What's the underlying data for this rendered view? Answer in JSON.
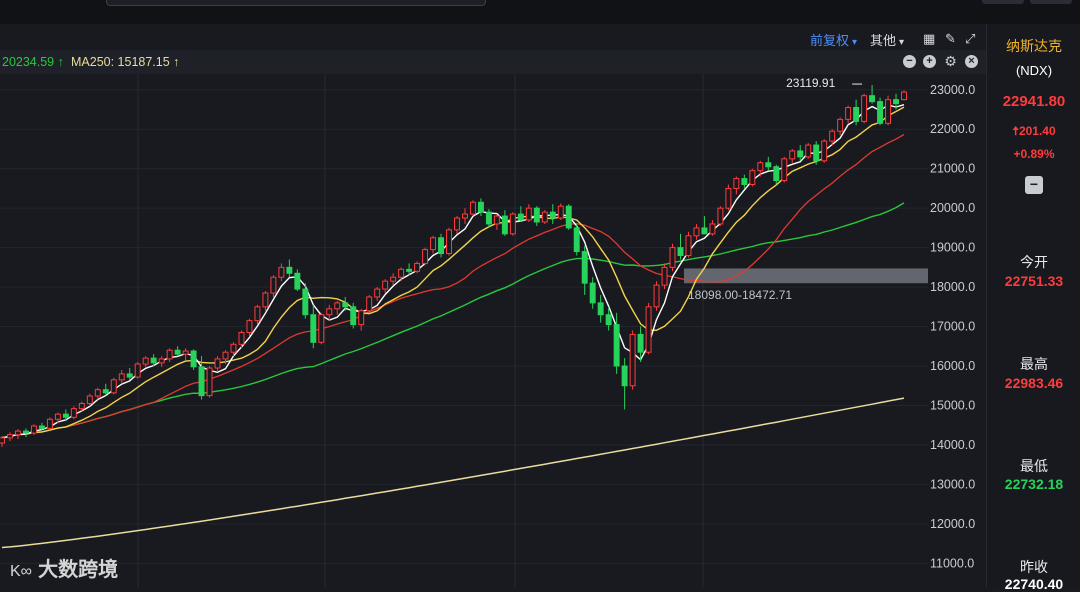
{
  "toolbar": {
    "adjust_label": "前复权",
    "other_label": "其他",
    "icons": [
      "grid-icon",
      "brush-icon",
      "expand-icon"
    ]
  },
  "ma_bar": {
    "ma_partial": "20234.59 ↑",
    "ma250": "MA250: 15187.15 ↑",
    "controls": [
      "minus-icon",
      "plus-icon",
      "gear-icon",
      "close-icon"
    ]
  },
  "sidebar": {
    "name": "纳斯达克",
    "code": "(NDX)",
    "price": "22941.80",
    "change": "201.40",
    "change_pct": "+0.89%",
    "open_label": "今开",
    "open_value": "22751.33",
    "high_label": "最高",
    "high_value": "22983.46",
    "low_label": "最低",
    "low_value": "22732.18",
    "prev_label": "昨收",
    "prev_value": "22740.40"
  },
  "watermark": {
    "text": "大数跨境",
    "logo": "K∞"
  },
  "colors": {
    "up": "#ff3b3b",
    "down": "#27d35a",
    "ma5": "#ffffff",
    "ma10": "#f3d34a",
    "ma20": "#e2392d",
    "ma60": "#28c83c",
    "ma250": "#e9dc9c",
    "accent": "#f0b429"
  },
  "chart_data": {
    "type": "candlestick",
    "y_ticks": [
      "23000.0",
      "22000.0",
      "21000.0",
      "20000.0",
      "19000.0",
      "18000.0",
      "17000.0",
      "16000.0",
      "15000.0",
      "14000.0",
      "13000.0",
      "12000.0",
      "11000.0"
    ],
    "ylim": [
      10400,
      23400
    ],
    "grid": true,
    "annotations": {
      "high_marker": "23119.91",
      "range_label": "18098.00-18472.71",
      "range": [
        18098.0,
        18472.71
      ]
    },
    "candles": [
      [
        14050,
        14230,
        13950,
        14180
      ],
      [
        14180,
        14320,
        14100,
        14260
      ],
      [
        14260,
        14400,
        14150,
        14350
      ],
      [
        14350,
        14420,
        14200,
        14300
      ],
      [
        14300,
        14520,
        14250,
        14480
      ],
      [
        14480,
        14560,
        14380,
        14420
      ],
      [
        14420,
        14700,
        14380,
        14650
      ],
      [
        14650,
        14820,
        14550,
        14780
      ],
      [
        14780,
        14900,
        14600,
        14700
      ],
      [
        14700,
        14980,
        14650,
        14920
      ],
      [
        14920,
        15100,
        14850,
        15050
      ],
      [
        15050,
        15300,
        14980,
        15240
      ],
      [
        15240,
        15450,
        15150,
        15400
      ],
      [
        15400,
        15550,
        15250,
        15320
      ],
      [
        15320,
        15700,
        15280,
        15650
      ],
      [
        15650,
        15900,
        15550,
        15800
      ],
      [
        15800,
        15950,
        15650,
        15720
      ],
      [
        15720,
        16100,
        15680,
        16050
      ],
      [
        16050,
        16250,
        15950,
        16200
      ],
      [
        16200,
        16300,
        16000,
        16080
      ],
      [
        16080,
        16250,
        15980,
        16180
      ],
      [
        16180,
        16450,
        16100,
        16400
      ],
      [
        16400,
        16500,
        16250,
        16300
      ],
      [
        16300,
        16450,
        16150,
        16380
      ],
      [
        16380,
        16420,
        15900,
        15980
      ],
      [
        15980,
        16250,
        15150,
        15250
      ],
      [
        15250,
        16000,
        15200,
        15950
      ],
      [
        15950,
        16250,
        15850,
        16180
      ],
      [
        16180,
        16400,
        16050,
        16350
      ],
      [
        16350,
        16600,
        16250,
        16550
      ],
      [
        16550,
        16900,
        16450,
        16850
      ],
      [
        16850,
        17200,
        16750,
        17150
      ],
      [
        17150,
        17550,
        17050,
        17500
      ],
      [
        17500,
        17900,
        17400,
        17850
      ],
      [
        17850,
        18300,
        17750,
        18250
      ],
      [
        18250,
        18600,
        18150,
        18500
      ],
      [
        18500,
        18700,
        18250,
        18350
      ],
      [
        18350,
        18450,
        17900,
        17950
      ],
      [
        17950,
        18100,
        17200,
        17300
      ],
      [
        17300,
        17550,
        16450,
        16600
      ],
      [
        16600,
        17350,
        16550,
        17300
      ],
      [
        17300,
        17550,
        17150,
        17450
      ],
      [
        17450,
        17650,
        17300,
        17600
      ],
      [
        17600,
        17750,
        17400,
        17500
      ],
      [
        17500,
        17600,
        16950,
        17050
      ],
      [
        17050,
        17450,
        16900,
        17400
      ],
      [
        17400,
        17800,
        17350,
        17750
      ],
      [
        17750,
        18000,
        17650,
        17950
      ],
      [
        17950,
        18200,
        17850,
        18150
      ],
      [
        18150,
        18350,
        18050,
        18250
      ],
      [
        18250,
        18500,
        18150,
        18450
      ],
      [
        18450,
        18600,
        18300,
        18400
      ],
      [
        18400,
        18650,
        18350,
        18600
      ],
      [
        18600,
        19000,
        18550,
        18950
      ],
      [
        18950,
        19300,
        18850,
        19250
      ],
      [
        19250,
        19350,
        18750,
        18850
      ],
      [
        18850,
        19500,
        18800,
        19450
      ],
      [
        19450,
        19800,
        19350,
        19750
      ],
      [
        19750,
        20000,
        19600,
        19850
      ],
      [
        19850,
        20200,
        19800,
        20150
      ],
      [
        20150,
        20250,
        19800,
        19900
      ],
      [
        19900,
        19980,
        19500,
        19600
      ],
      [
        19600,
        19850,
        19450,
        19800
      ],
      [
        19800,
        19950,
        19300,
        19350
      ],
      [
        19350,
        19900,
        19300,
        19850
      ],
      [
        19850,
        20050,
        19650,
        19700
      ],
      [
        19700,
        20100,
        19650,
        20000
      ],
      [
        20000,
        20050,
        19550,
        19650
      ],
      [
        19650,
        19950,
        19600,
        19900
      ],
      [
        19900,
        20100,
        19600,
        19750
      ],
      [
        19750,
        20120,
        19700,
        20050
      ],
      [
        20050,
        20100,
        19450,
        19500
      ],
      [
        19500,
        19600,
        18800,
        18900
      ],
      [
        18900,
        19050,
        17800,
        18100
      ],
      [
        18100,
        18250,
        17450,
        17600
      ],
      [
        17600,
        17800,
        17100,
        17300
      ],
      [
        17300,
        17500,
        16900,
        17050
      ],
      [
        17050,
        17350,
        15800,
        16000
      ],
      [
        16000,
        16200,
        14900,
        15500
      ],
      [
        15500,
        16900,
        15400,
        16800
      ],
      [
        16800,
        17000,
        16100,
        16350
      ],
      [
        16350,
        17600,
        16300,
        17500
      ],
      [
        17500,
        18150,
        17400,
        18050
      ],
      [
        18050,
        18600,
        17950,
        18500
      ],
      [
        18500,
        19100,
        18400,
        19000
      ],
      [
        19000,
        19350,
        18700,
        18800
      ],
      [
        18800,
        19400,
        18750,
        19300
      ],
      [
        19300,
        19600,
        19200,
        19500
      ],
      [
        19500,
        19800,
        19400,
        19350
      ],
      [
        19350,
        19700,
        19300,
        19600
      ],
      [
        19600,
        20050,
        19550,
        20000
      ],
      [
        20000,
        20600,
        19950,
        20500
      ],
      [
        20500,
        20800,
        20350,
        20750
      ],
      [
        20750,
        20850,
        20500,
        20600
      ],
      [
        20600,
        21000,
        20550,
        20950
      ],
      [
        20950,
        21200,
        20800,
        21150
      ],
      [
        21150,
        21300,
        20950,
        21050
      ],
      [
        21050,
        21100,
        20600,
        20700
      ],
      [
        20700,
        21300,
        20650,
        21250
      ],
      [
        21250,
        21500,
        21150,
        21450
      ],
      [
        21450,
        21600,
        21200,
        21300
      ],
      [
        21300,
        21650,
        21250,
        21600
      ],
      [
        21600,
        21700,
        21100,
        21200
      ],
      [
        21200,
        21750,
        21150,
        21700
      ],
      [
        21700,
        22000,
        21600,
        21950
      ],
      [
        21950,
        22300,
        21850,
        22250
      ],
      [
        22250,
        22600,
        22150,
        22550
      ],
      [
        22550,
        22750,
        22100,
        22200
      ],
      [
        22200,
        22900,
        22150,
        22850
      ],
      [
        22850,
        23119.91,
        22650,
        22700
      ],
      [
        22700,
        22800,
        22100,
        22150
      ],
      [
        22150,
        22850,
        22100,
        22750
      ],
      [
        22750,
        22900,
        22500,
        22650
      ],
      [
        22751.33,
        22983.46,
        22732.18,
        22941.8
      ]
    ],
    "ma_lines": [
      {
        "name": "MA5",
        "values_at_end": 22700
      },
      {
        "name": "MA10",
        "values_at_end": 22200
      },
      {
        "name": "MA20",
        "values_at_end": 21400
      },
      {
        "name": "MA60",
        "values_at_end": 20234.59
      },
      {
        "name": "MA250",
        "values_at_end": 15187.15,
        "start": 11400
      }
    ]
  }
}
